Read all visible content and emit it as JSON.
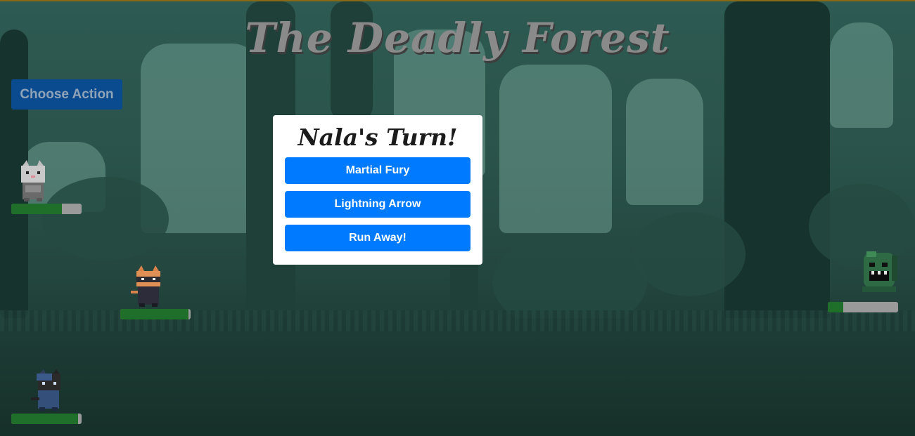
{
  "game": {
    "title": "The Deadly Forest"
  },
  "controls": {
    "choose_action_label": "Choose Action"
  },
  "turn_panel": {
    "title": "Nala's Turn!",
    "actions": [
      {
        "label": "Martial Fury"
      },
      {
        "label": "Lightning Arrow"
      },
      {
        "label": "Run Away!"
      }
    ]
  },
  "characters": {
    "heroes": [
      {
        "sprite": "grey-cat-knight",
        "hp_fraction": 0.72
      },
      {
        "sprite": "orange-cat-ninja",
        "hp_fraction": 0.97
      },
      {
        "sprite": "black-cat-mage",
        "hp_fraction": 0.95
      }
    ],
    "enemy": {
      "sprite": "green-goblin",
      "hp_fraction": 0.22
    }
  },
  "colors": {
    "action_button": "#007bff",
    "choose_action_bg": "#0a4a8f",
    "hp_fill": "#1f6e2a",
    "hp_empty": "#9a9a9a"
  }
}
